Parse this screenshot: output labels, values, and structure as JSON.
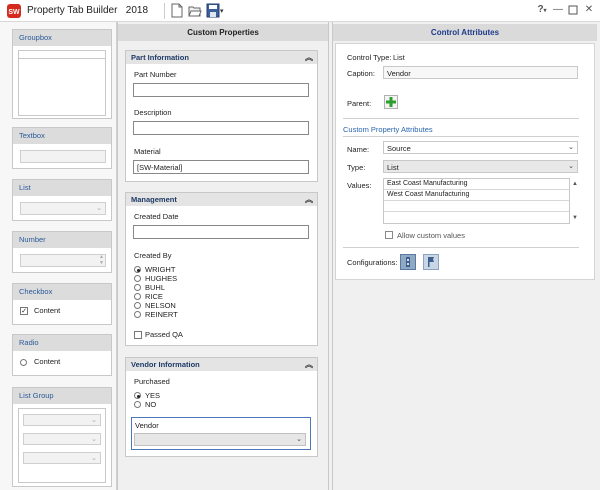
{
  "titlebar": {
    "title": "Property Tab Builder",
    "version": "2018",
    "logo_text": "SW",
    "help_label": "?",
    "icons": [
      "new-file-icon",
      "open-folder-icon",
      "save-disk-icon",
      "dropdown-arrow-icon",
      "help-icon",
      "minimize-icon",
      "maximize-icon",
      "close-icon"
    ]
  },
  "palette": {
    "groupbox": "Groupbox",
    "textbox": "Textbox",
    "list": "List",
    "number": "Number",
    "checkbox": "Checkbox",
    "checkbox_content": "Content",
    "radio": "Radio",
    "radio_content": "Content",
    "list_group": "List Group"
  },
  "custom_properties": {
    "header": "Custom Properties",
    "part_information": {
      "title": "Part Information",
      "part_number_label": "Part Number",
      "part_number_value": "",
      "description_label": "Description",
      "description_value": "",
      "material_label": "Material",
      "material_value": "[SW-Material]"
    },
    "management": {
      "title": "Management",
      "created_date_label": "Created Date",
      "created_date_value": "",
      "created_by_label": "Created By",
      "options": [
        "WRIGHT",
        "HUGHES",
        "BUHL",
        "RICE",
        "NELSON",
        "REINERT"
      ],
      "selected": "WRIGHT",
      "passed_qa_label": "Passed QA"
    },
    "vendor_information": {
      "title": "Vendor Information",
      "purchased_label": "Purchased",
      "purchased_options": [
        "YES",
        "NO"
      ],
      "purchased_selected": "YES",
      "vendor_label": "Vendor",
      "vendor_value": ""
    }
  },
  "control_attributes": {
    "header": "Control Attributes",
    "control_type_label": "Control Type:",
    "control_type_value": "List",
    "caption_label": "Caption:",
    "caption_value": "Vendor",
    "parent_label": "Parent:",
    "custom_property_attributes": "Custom Property Attributes",
    "name_label": "Name:",
    "name_value": "Source",
    "type_label": "Type:",
    "type_value": "List",
    "values_label": "Values:",
    "values": [
      "East Coast Manufacturing",
      "West Coast Manufacturing"
    ],
    "allow_custom_label": "Allow custom values",
    "configurations_label": "Configurations:"
  },
  "colors": {
    "accent_blue": "#2a66b0",
    "header_bg": "#dadada",
    "add_button_green": "#2e9e2e",
    "logo_red": "#d52b1e"
  }
}
